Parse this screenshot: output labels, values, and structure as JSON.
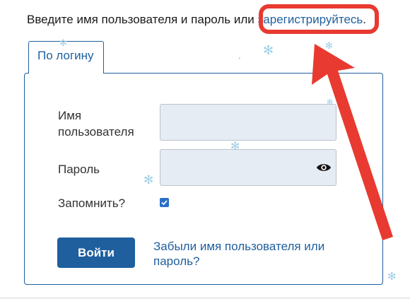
{
  "intro": {
    "text": "Введите имя пользователя и пароль или ",
    "register_link": "зарегистрируйтесь",
    "suffix": "."
  },
  "tab": {
    "label": "По логину"
  },
  "form": {
    "username_label": "Имя пользователя",
    "username_value": "",
    "password_label": "Пароль",
    "password_value": "",
    "remember_label": "Запомнить?",
    "remember_checked": true,
    "login_button": "Войти",
    "forgot_link": "Забыли имя пользователя или пароль?"
  },
  "icons": {
    "password_toggle": "eye-icon",
    "remember_checkbox": "checkmark-icon",
    "decorations": "snowflake-icon"
  },
  "colors": {
    "link": "#1f5f9e",
    "button": "#1f5f9e",
    "field_bg": "#e6ecf3",
    "annotation": "#e83a30"
  }
}
